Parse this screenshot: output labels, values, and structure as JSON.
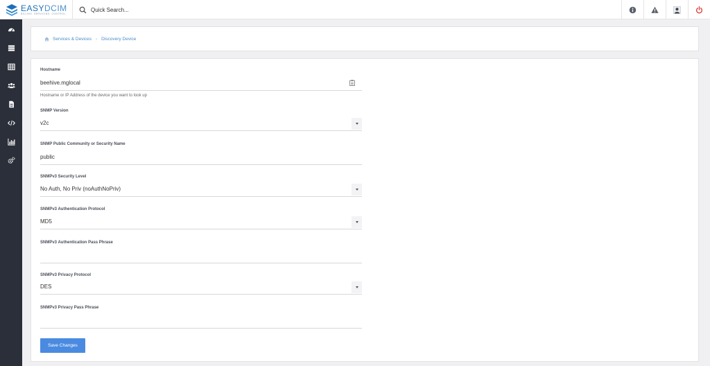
{
  "brand": {
    "name_part1": "EASY",
    "name_part2": "DCIM",
    "tagline": "BILLING. SERVICING. CONTROL."
  },
  "search": {
    "placeholder": "Quick Search..."
  },
  "topbar_actions": [
    {
      "icon": "info-icon"
    },
    {
      "icon": "warning-icon"
    },
    {
      "icon": "user-icon"
    },
    {
      "icon": "power-icon",
      "color": "#e04040"
    }
  ],
  "sidebar": {
    "items": [
      {
        "icon": "dashboard-icon"
      },
      {
        "icon": "server-list-icon"
      },
      {
        "icon": "table-icon"
      },
      {
        "icon": "users-icon"
      },
      {
        "icon": "document-icon"
      },
      {
        "icon": "code-icon"
      },
      {
        "icon": "bar-chart-icon"
      },
      {
        "icon": "settings-icon"
      }
    ]
  },
  "breadcrumb": {
    "items": [
      "Services & Devices",
      "Discovery Device"
    ]
  },
  "form": {
    "hostname": {
      "label": "Hostname",
      "value": "beehive.mglocal",
      "help": "Hostname or IP Address of the device you want to look up"
    },
    "snmp_version": {
      "label": "SNMP Version",
      "value": "v2c"
    },
    "snmp_community": {
      "label": "SNMP Public Community or Security Name",
      "value": "public"
    },
    "security_level": {
      "label": "SNMPv3 Security Level",
      "value": "No Auth, No Priv (noAuthNoPriv)"
    },
    "auth_protocol": {
      "label": "SNMPv3 Authentication Protocol",
      "value": "MD5"
    },
    "auth_pass": {
      "label": "SNMPv3 Authentication Pass Phrase",
      "value": ""
    },
    "priv_protocol": {
      "label": "SNMPv3 Privacy Protocol",
      "value": "DES"
    },
    "priv_pass": {
      "label": "SNMPv3 Privacy Pass Phrase",
      "value": ""
    },
    "save_label": "Save Changes"
  },
  "colors": {
    "accent": "#4a8ae0",
    "sidebar_bg": "#2b2f3a",
    "link": "#4a8cc8",
    "power": "#e04040"
  }
}
